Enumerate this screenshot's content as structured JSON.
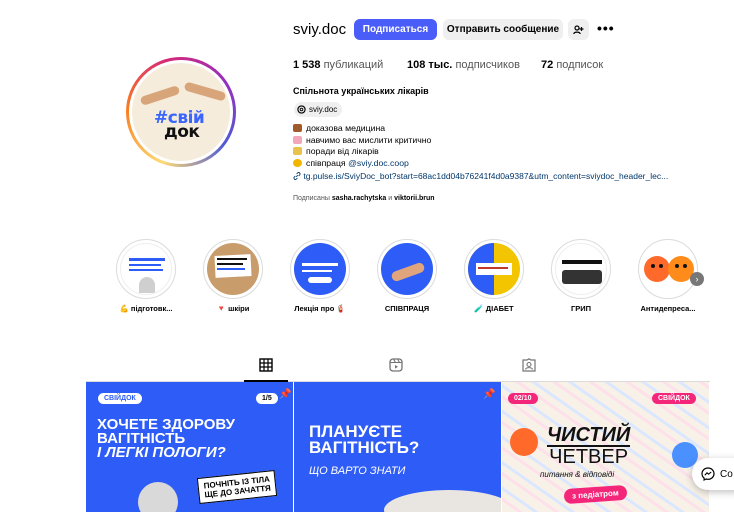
{
  "profile": {
    "username": "sviy.doc",
    "follow_label": "Подписаться",
    "message_label": "Отправить сообщение",
    "posts_count": "1 538",
    "posts_label": "публикаций",
    "followers_count": "108 тыс.",
    "followers_label": "подписчиков",
    "following_count": "72",
    "following_label": "подписок",
    "full_name": "Спільнота українських лікарів",
    "threads_handle": "sviy.doc",
    "bio": [
      {
        "icon": "pill-emoji",
        "color": "#a05a2c",
        "text": "доказова медицина"
      },
      {
        "icon": "brain-emoji",
        "color": "#f4a7b9",
        "text": "навчимо вас мислити критично"
      },
      {
        "icon": "clipboard-emoji",
        "color": "#e8c24a",
        "text": "поради від лікарів"
      },
      {
        "icon": "heart-emoji",
        "color": "#f2b600",
        "text_prefix": "співпраця",
        "mention": "@sviy.doc.coop"
      }
    ],
    "link": "tg.pulse.is/SviyDoc_bot?start=68ac1dd04b76241f4d0a9387&utm_content=sviydoc_header_lec...",
    "followed_by_prefix": "Подписаны",
    "followed_by_user1": "sasha.rachytska",
    "followed_by_and": "и",
    "followed_by_user2": "viktorii.brun",
    "avatar_text_line1": "#свій",
    "avatar_text_line2": "док"
  },
  "highlights": [
    {
      "label": "💪 підготовк...",
      "bg": "#ffffff"
    },
    {
      "label": "🔻 шкіри",
      "bg": "#c99c6c"
    },
    {
      "label": "Лекція про 🧯",
      "bg": "#2e5cf6"
    },
    {
      "label": "СПІВПРАЦЯ",
      "bg": "#2e5cf6"
    },
    {
      "label": "🧪 ДІАБЕТ",
      "bg": "#f2c500"
    },
    {
      "label": "ГРИП",
      "bg": "#ffffff"
    },
    {
      "label": "Антидепреса...",
      "bg": "#ff6a2a"
    }
  ],
  "tabs": [
    {
      "name": "tab-posts",
      "icon": "grid-icon",
      "active": true
    },
    {
      "name": "tab-reels",
      "icon": "reels-icon",
      "active": false
    },
    {
      "name": "tab-tagged",
      "icon": "tagged-icon",
      "active": false
    }
  ],
  "posts": {
    "p1": {
      "tag": "СВІЙДОК",
      "counter": "1/5",
      "line1": "ХОЧЕТЕ ЗДОРОВУ",
      "line2": "ВАГІТНІСТЬ",
      "line3": "І ЛЕГКІ ПОЛОГИ?",
      "sticker1": "ПОЧНІТЬ ІЗ ТІЛА",
      "sticker2": "ЩЕ ДО ЗАЧАТТЯ"
    },
    "p2": {
      "line1": "ПЛАНУЄТЕ",
      "line2": "ВАГІТНІСТЬ?",
      "sub": "ЩО ВАРТО ЗНАТИ"
    },
    "p3": {
      "date": "02/10",
      "tag": "СВІЙДОК",
      "line1": "ЧИСТИЙ",
      "line2": "ЧЕТВЕР",
      "sub": "питання & відповіді",
      "pill": "з педіатром"
    }
  },
  "messenger_label": "Co",
  "colors": {
    "accent": "#4a5df9",
    "brand_blue": "#2e5cf6",
    "link": "#00376b"
  }
}
